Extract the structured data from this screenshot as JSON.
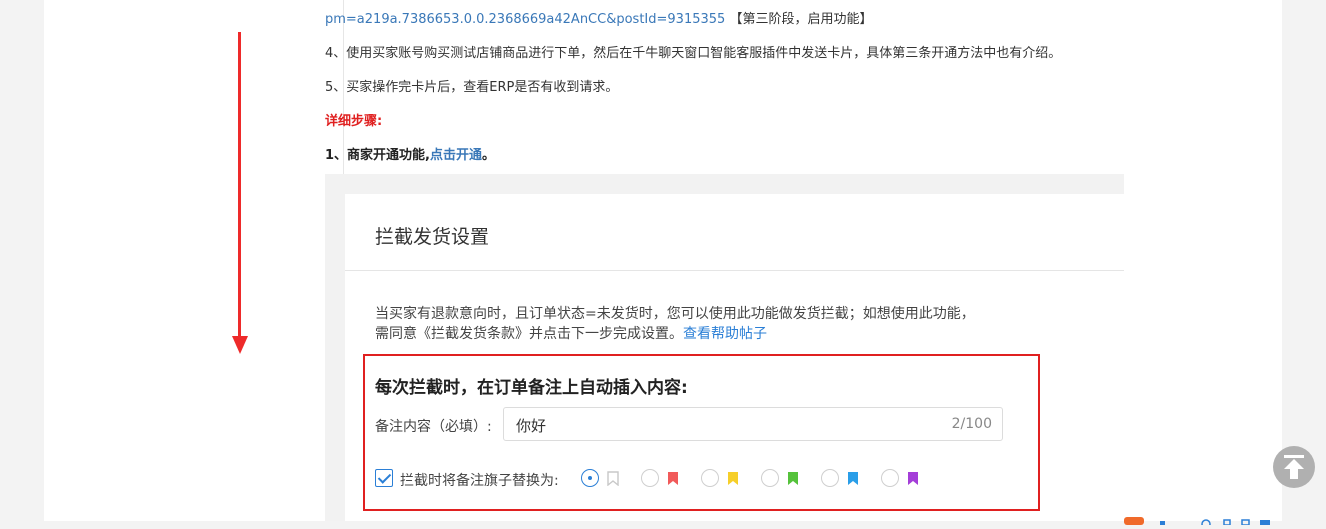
{
  "article": {
    "line_url": "pm=a219a.7386653.0.0.2368669a42AnCC&postId=9315355",
    "line_url_suffix": "【第三阶段，启用功能】",
    "line_step4": "4、使用买家账号购买测试店铺商品进行下单，然后在千牛聊天窗口智能客服插件中发送卡片，具体第三条开通方法中也有介绍。",
    "line_step5": "5、买家操作完卡片后，查看ERP是否有收到请求。",
    "detail_heading": "详细步骤:",
    "step1_prefix": "1、商家开通功能,",
    "step1_link": "点击开通",
    "step1_suffix": "。"
  },
  "panel": {
    "title": "拦截发货设置",
    "desc_line1": "当买家有退款意向时，且订单状态=未发货时，您可以使用此功能做发货拦截；如想使用此功能，",
    "desc_line2": "需同意《拦截发货条款》并点击下一步完成设置。",
    "help_link": "查看帮助帖子",
    "box_title": "每次拦截时，在订单备注上自动插入内容:",
    "note_label": "备注内容（必填）:",
    "note_value": "你好",
    "note_count": "2/100",
    "replace_flag_label": "拦截时将备注旗子替换为:",
    "replace_flag_checked": true,
    "flags": [
      {
        "name": "none",
        "color": "#c8c8c8",
        "selected": true
      },
      {
        "name": "red",
        "color": "#f15a5a",
        "selected": false
      },
      {
        "name": "yellow",
        "color": "#f6cf2a",
        "selected": false
      },
      {
        "name": "green",
        "color": "#55c23b",
        "selected": false
      },
      {
        "name": "blue",
        "color": "#2a9ee8",
        "selected": false
      },
      {
        "name": "purple",
        "color": "#a43ed8",
        "selected": false
      }
    ]
  },
  "colors": {
    "annotation_red": "#e02020",
    "link_blue": "#2b7fd6",
    "article_link": "#3a78b8"
  }
}
